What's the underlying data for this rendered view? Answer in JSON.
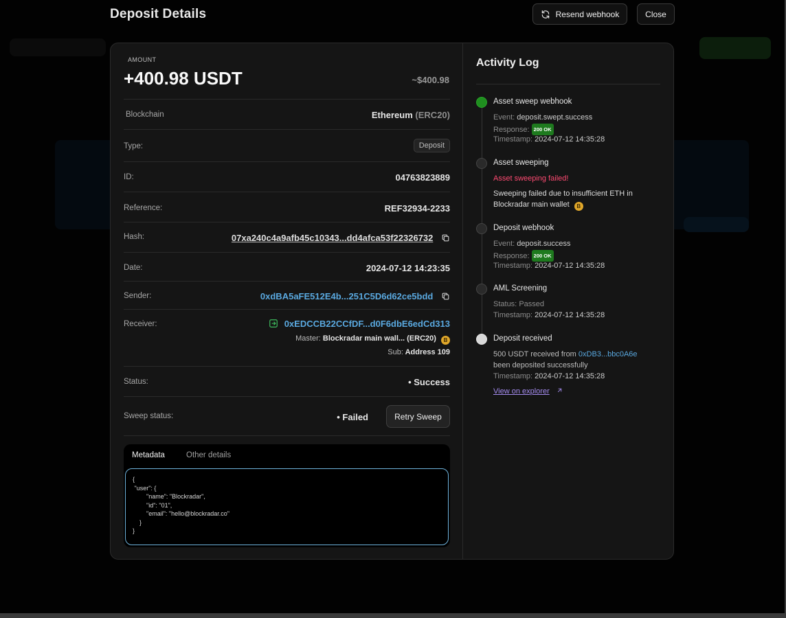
{
  "page": {
    "title": "Deposit Details",
    "resend_label": "Resend webhook",
    "close_label": "Close"
  },
  "summary": {
    "amount_label": "AMOUNT",
    "amount": "+400.98 USDT",
    "approx": "~$400.98"
  },
  "details": {
    "blockchain": {
      "label": "Blockchain",
      "name": "Ethereum",
      "standard": "(ERC20)"
    },
    "type": {
      "label": "Type:",
      "value": "Deposit"
    },
    "id": {
      "label": "ID:",
      "value": "04763823889"
    },
    "reference": {
      "label": "Reference:",
      "value": "REF32934-2233"
    },
    "hash": {
      "label": "Hash:",
      "value": "07xa240c4a9afb45c10343...dd4afca53f22326732"
    },
    "date": {
      "label": "Date:",
      "value": "2024-07-12 14:23:35"
    },
    "sender": {
      "label": "Sender:",
      "value": "0xdBA5aFE512E4b...251C5D6d62ce5bdd"
    },
    "receiver": {
      "label": "Receiver:",
      "value": "0xEDCCB22CCfDF...d0F6dbE6edCd313",
      "master_label": "Master:",
      "master_value": "Blockradar main wall... (ERC20)",
      "sub_label": "Sub:",
      "sub_value": "Address 109"
    },
    "status": {
      "label": "Status:",
      "value": "• Success"
    },
    "sweep": {
      "label": "Sweep status:",
      "value": "• Failed",
      "retry_label": "Retry Sweep"
    }
  },
  "metadata": {
    "tabs": [
      "Metadata",
      "Other details"
    ],
    "code": "{\n \"user\": {\n        \"name\": \"Blockradar\",\n        \"id\": \"01\",\n        \"email\": \"hello@blockradar.co\"\n    }\n}"
  },
  "activity": {
    "title": "Activity Log",
    "events": [
      {
        "title": "Asset sweep webhook",
        "event_label": "Event:",
        "event_value": "deposit.swept.success",
        "response_label": "Response:",
        "response_value": "200 OK",
        "timestamp_label": "Timestamp:",
        "timestamp_value": "2024-07-12 14:35:28"
      },
      {
        "title": "Asset sweeping",
        "error": "Asset sweeping failed!",
        "message_1": "Sweeping failed due to insufficient ETH in",
        "message_2": "Blockradar main wallet"
      },
      {
        "title": "Deposit webhook",
        "event_label": "Event:",
        "event_value": "deposit.success",
        "response_label": "Response:",
        "response_value": "200 OK",
        "timestamp_label": "Timestamp:",
        "timestamp_value": "2024-07-12 14:35:28"
      },
      {
        "title": "AML Screening",
        "status_label": "Status:",
        "status_value": "Passed",
        "timestamp_label": "Timestamp:",
        "timestamp_value": "2024-07-12 14:35:28"
      },
      {
        "title": "Deposit received",
        "line_1": "500 USDT received from",
        "address": "0xDB3...bbc0A6e",
        "line_2": "been deposited successfully",
        "timestamp_label": "Timestamp:",
        "timestamp_value": "2024-07-12 14:35:28",
        "explorer_label": "View on explorer"
      }
    ]
  },
  "colors": {
    "success": "#2fd06c",
    "failed": "#ff3d6a",
    "link": "#5aa9e0",
    "ok_badge": "#1e7a1e",
    "coin": "#e0a72a",
    "explorer": "#a58cf0"
  },
  "icons": {
    "resend": "refresh-icon",
    "copy": "copy-icon",
    "receiver": "arrow-into-box-icon",
    "coin": "bnb-coin-icon",
    "external": "arrow-up-right-icon"
  }
}
